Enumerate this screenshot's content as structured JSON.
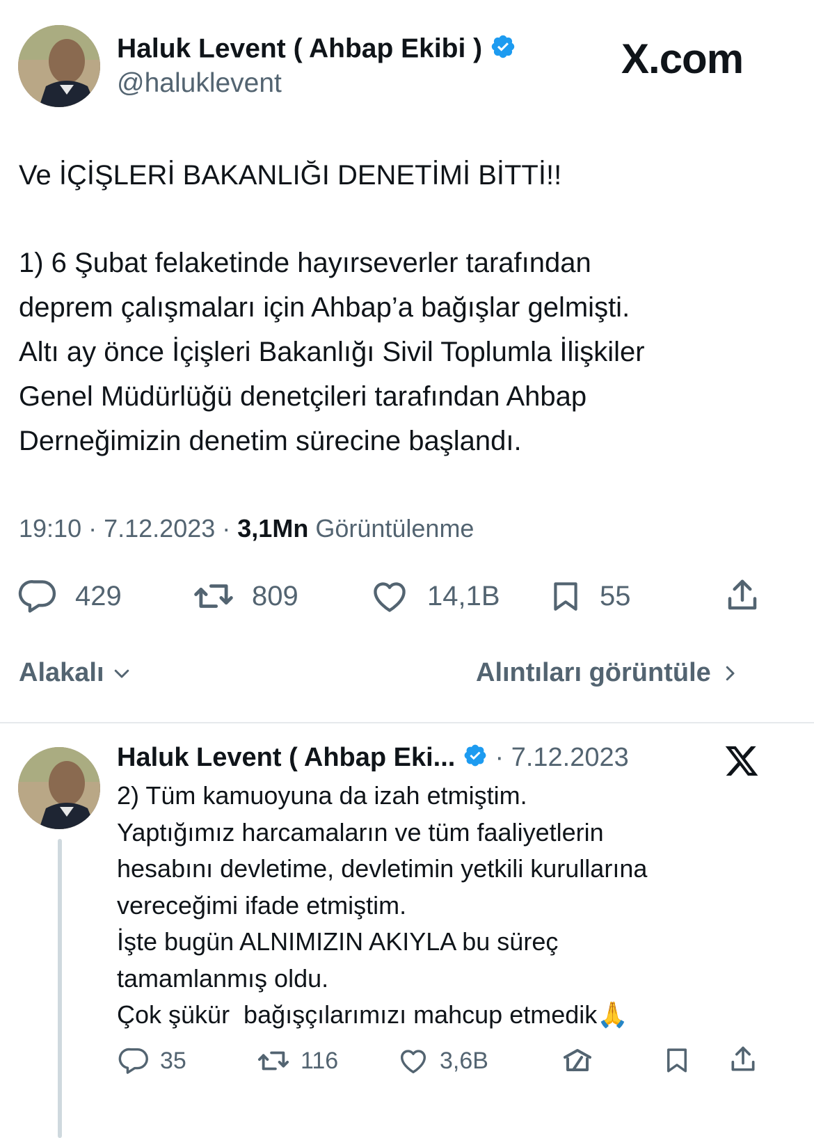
{
  "brand": "X.com",
  "main_tweet": {
    "author_name": "Haluk Levent ( Ahbap Ekibi )",
    "author_handle": "@haluklevent",
    "headline": "Ve İÇİŞLERİ BAKANLIĞI DENETİMİ BİTTİ!!",
    "body": "1) 6 Şubat felaketinde hayırseverler tarafından\ndeprem çalışmaları için Ahbap’a bağışlar gelmişti.\nAltı ay önce İçişleri Bakanlığı Sivil Toplumla İlişkiler\nGenel Müdürlüğü denetçileri tarafından Ahbap\nDerneğimizin denetim sürecine başlandı.",
    "time": "19:10",
    "date": "7.12.2023",
    "views_count": "3,1Mn",
    "views_label": "Görüntülenme",
    "replies": "429",
    "reposts": "809",
    "likes": "14,1B",
    "bookmarks": "55"
  },
  "related": {
    "left_label": "Alakalı",
    "right_label": "Alıntıları görüntüle"
  },
  "reply_tweet": {
    "author_name": "Haluk Levent ( Ahbap Eki...",
    "date": "7.12.2023",
    "body": "2) Tüm kamuoyuna da izah etmiştim.\nYaptığımız harcamaların ve tüm faaliyetlerin\nhesabını devletime, devletimin yetkili kurullarına\nvereceğimi ifade etmiştim.\nİşte bugün ALNIMIZIN AKIYLA bu süreç\ntamamlanmış oldu.\nÇok şükür  bağışçılarımızı mahcup etmedik🙏",
    "replies": "35",
    "reposts": "116",
    "likes": "3,6B"
  },
  "colors": {
    "text_primary": "#0f1419",
    "text_secondary": "#536471",
    "verified_blue": "#1d9bf0",
    "divider": "#e6e9ec"
  },
  "icons": [
    "verified-badge-icon",
    "x-logo-icon",
    "reply-icon",
    "repost-icon",
    "like-icon",
    "bookmark-icon",
    "share-icon",
    "chevron-down-icon",
    "chevron-right-icon",
    "grok-icon"
  ]
}
